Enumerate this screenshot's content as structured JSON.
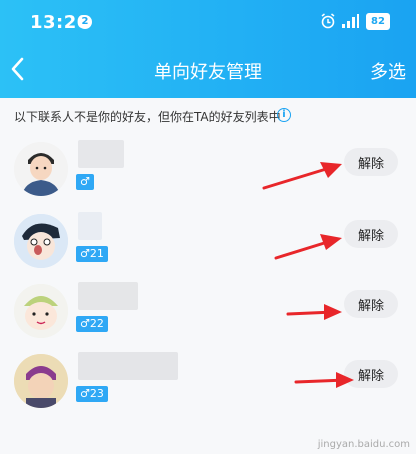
{
  "status": {
    "time": "13:20",
    "notif_count": "2",
    "battery": "82"
  },
  "nav": {
    "back": "‹",
    "title": "单向好友管理",
    "multi_select": "多选"
  },
  "notice": "以下联系人不是你的好友，但你在TA的好友列表中",
  "info_icon": "i",
  "contacts": [
    {
      "tag": "♂",
      "action": "解除"
    },
    {
      "tag": "♂21",
      "action": "解除"
    },
    {
      "tag": "♂22",
      "action": "解除"
    },
    {
      "tag": "♂23",
      "action": "解除"
    }
  ],
  "watermark": "jingyan.baidu.com",
  "colors": {
    "header": "#1aa3f2",
    "tag": "#2fa8f5",
    "arrow": "#e8262a"
  }
}
